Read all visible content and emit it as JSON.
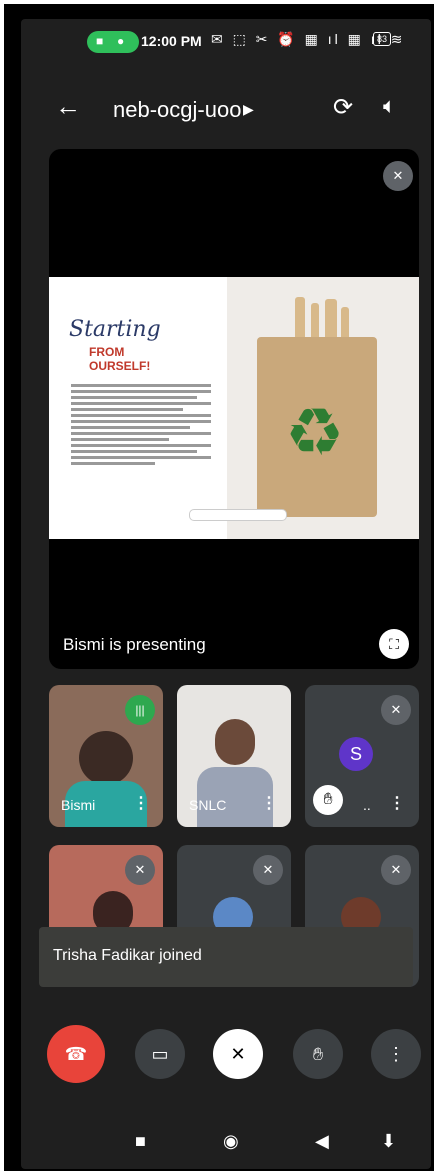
{
  "status_bar": {
    "time": "12:00 PM",
    "battery": "83"
  },
  "header": {
    "meeting_code": "neb-ocgj-uoo"
  },
  "presentation": {
    "slide_title_script": "Starting",
    "slide_title_line1": "FROM",
    "slide_title_line2": "OURSELF!",
    "presenting_text": "Bismi is presenting"
  },
  "participants": [
    {
      "name": "Bismi"
    },
    {
      "name": "SNLC"
    },
    {
      "name": "..",
      "avatar_letter": "S"
    }
  ],
  "toast": {
    "message": "Trisha Fadikar joined"
  },
  "colors": {
    "end_call": "#e8443a",
    "speaking": "#2ea84f",
    "avatar_s": "#5f35c9"
  }
}
